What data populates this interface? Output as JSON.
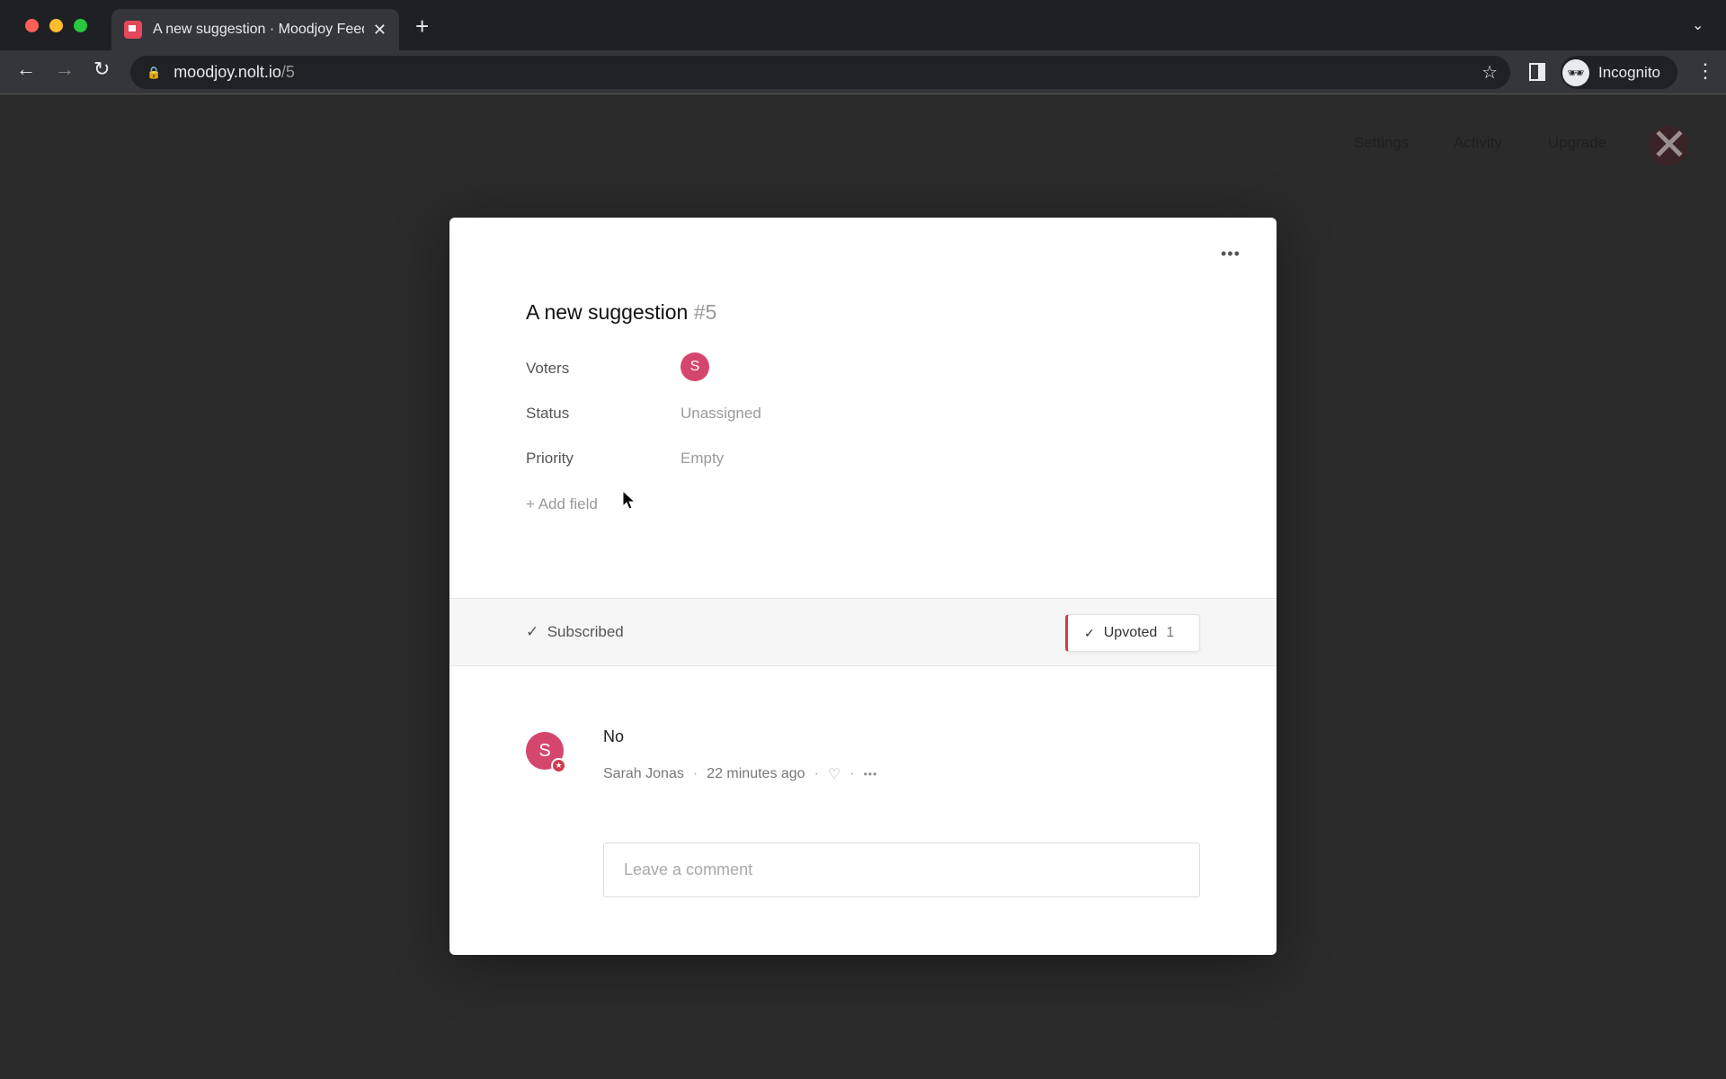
{
  "browser": {
    "tab_title": "A new suggestion · Moodjoy Feedback",
    "url_host": "moodjoy.nolt.io",
    "url_path": "/5",
    "profile_label": "Incognito"
  },
  "nav": {
    "items": [
      "Settings",
      "Activity",
      "Upgrade"
    ]
  },
  "post": {
    "title": "A new suggestion",
    "number": "#5",
    "fields": [
      {
        "label": "Voters",
        "avatar": "S"
      },
      {
        "label": "Status",
        "value": "Unassigned"
      },
      {
        "label": "Priority",
        "value": "Empty"
      }
    ],
    "add_field": "+ Add field",
    "subscribed": "Subscribed",
    "upvote_label": "Upvoted",
    "upvote_count": "1"
  },
  "comments": [
    {
      "avatar": "S",
      "text": "No",
      "author": "Sarah Jonas",
      "time": "22 minutes ago"
    }
  ],
  "comment_input": {
    "placeholder": "Leave a comment"
  },
  "colors": {
    "accent": "#d3394d",
    "avatar": "#d5466d"
  }
}
